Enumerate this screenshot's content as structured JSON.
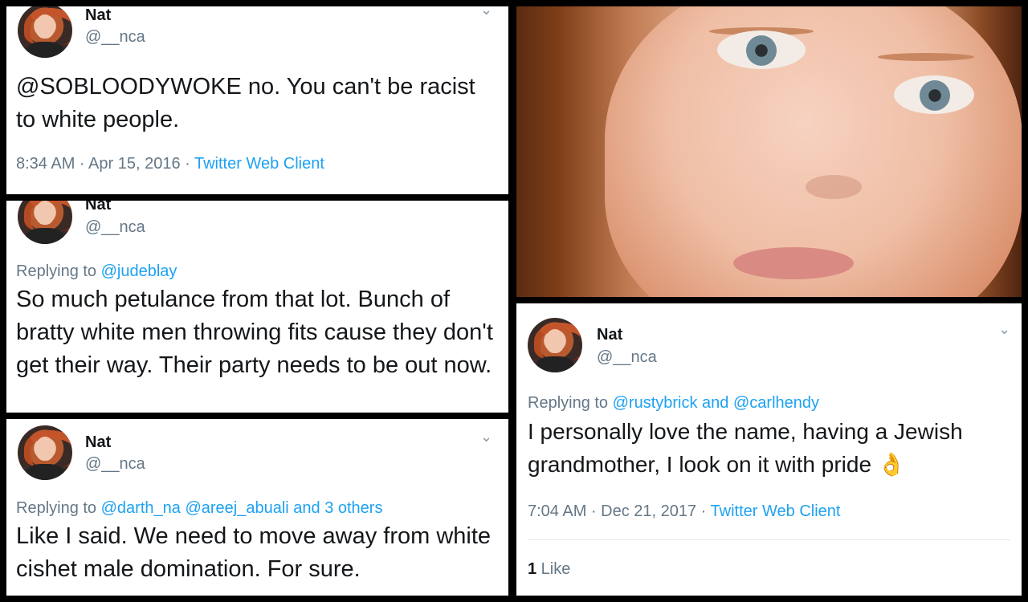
{
  "tweets": [
    {
      "name": "Nat",
      "handle": "@__nca",
      "text": "@SOBLOODYWOKE no. You can't be racist to white people.",
      "time": "8:34 AM · Apr 15, 2016 · ",
      "client": "Twitter Web Client"
    },
    {
      "name": "Nat",
      "handle": "@__nca",
      "reply_prefix": "Replying to ",
      "reply_to": "@judeblay",
      "text": "So much petulance from that lot. Bunch of bratty white men throwing fits cause they don't get their way. Their party needs to be out now."
    },
    {
      "name": "Nat",
      "handle": "@__nca",
      "reply_prefix": "Replying to ",
      "reply_to": "@darth_na @areej_abuali and 3 others",
      "text": "Like I said. We need to move away from white cishet male domination. For sure."
    },
    {
      "name": "Nat",
      "handle": "@__nca",
      "reply_prefix": "Replying to ",
      "reply_to": "@rustybrick and @carlhendy",
      "text": "I personally love the name, having a Jewish grandmother, I look on it with pride 👌",
      "time": "7:04 AM · Dec 21, 2017 · ",
      "client": "Twitter Web Client",
      "like_count": "1",
      "like_label": " Like"
    }
  ],
  "icons": {
    "chevron": "⌄"
  }
}
